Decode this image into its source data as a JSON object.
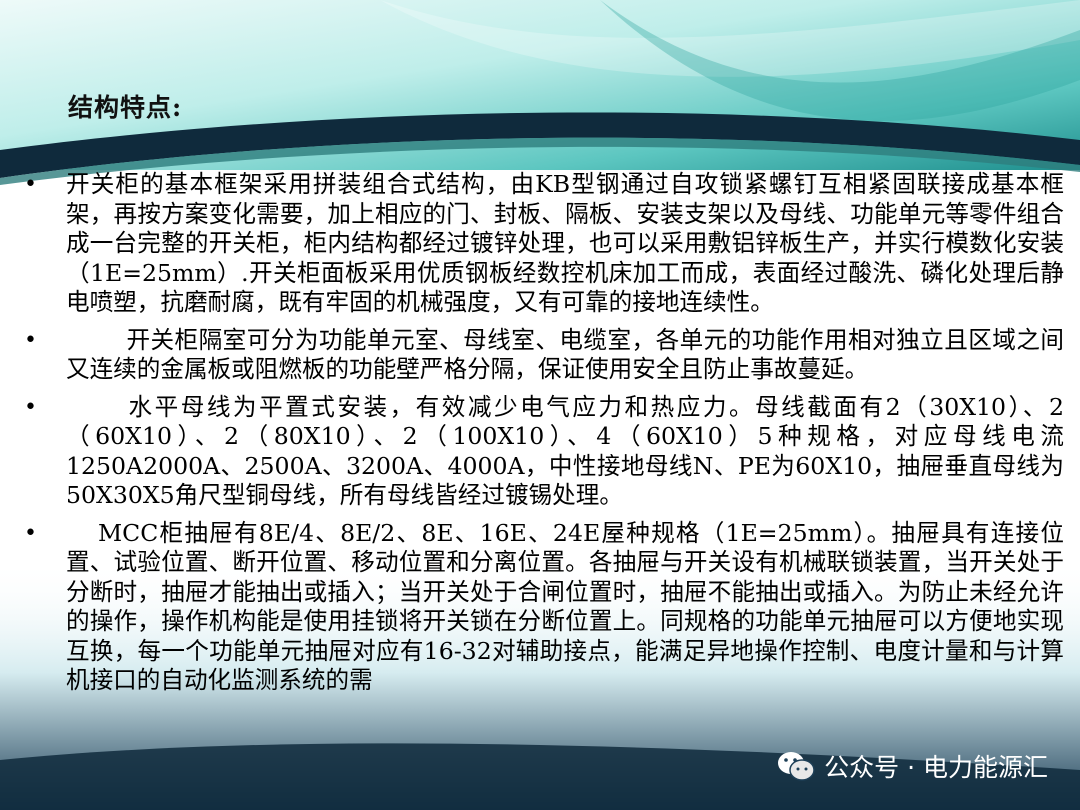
{
  "slide": {
    "title": "结构特点:",
    "bullets": [
      {
        "marker": "•",
        "text": "开关柜的基本框架采用拼装组合式结构，由KB型钢通过自攻锁紧螺钉互相紧固联接成基本框架，再按方案变化需要，加上相应的门、封板、隔板、安装支架以及母线、功能单元等零件组合成一台完整的开关柜，柜内结构都经过镀锌处理，也可以采用敷铝锌板生产，并实行模数化安装（1E=25mm）.开关柜面板采用优质钢板经数控机床加工而成，表面经过酸洗、磷化处理后静电喷塑，抗磨耐腐，既有牢固的机械强度，又有可靠的接地连续性。"
      },
      {
        "marker": "•",
        "text": "开关柜隔室可分为功能单元室、母线室、电缆室，各单元的功能作用相对独立且区域之间又连续的金属板或阻燃板的功能壁严格分隔，保证使用安全且防止事故蔓延。"
      },
      {
        "marker": "•",
        "text": "水平母线为平置式安装，有效减少电气应力和热应力。母线截面有2（30X10）、2（60X10）、2（80X10）、2（100X10）、4（60X10）5种规格，对应母线电流1250A2000A、2500A、3200A、4000A，中性接地母线N、PE为60X10，抽屉垂直母线为50X30X5角尺型铜母线，所有母线皆经过镀锡处理。"
      },
      {
        "marker": "•",
        "text": "MCC柜抽屉有8E/4、8E/2、8E、16E、24E屋种规格（1E=25mm）。抽屉具有连接位置、试验位置、断开位置、移动位置和分离位置。各抽屉与开关设有机械联锁装置，当开关处于分断时，抽屉才能抽出或插入；当开关处于合闸位置时，抽屉不能抽出或插入。为防止未经允许的操作，操作机构能是使用挂锁将开关锁在分断位置上。同规格的功能单元抽屉可以方便地实现互换，每一个功能单元抽屉对应有16-32对辅助接点，能满足异地操作控制、电度计量和与计算机接口的自动化监测系统的需"
      }
    ]
  },
  "watermark": {
    "icon": "wechat-icon",
    "text": "公众号 · 电力能源汇"
  },
  "colors": {
    "teal_light": "#bdeeea",
    "teal_mid": "#3fb5b0",
    "navy": "#0f2a3c",
    "text": "#000000"
  }
}
